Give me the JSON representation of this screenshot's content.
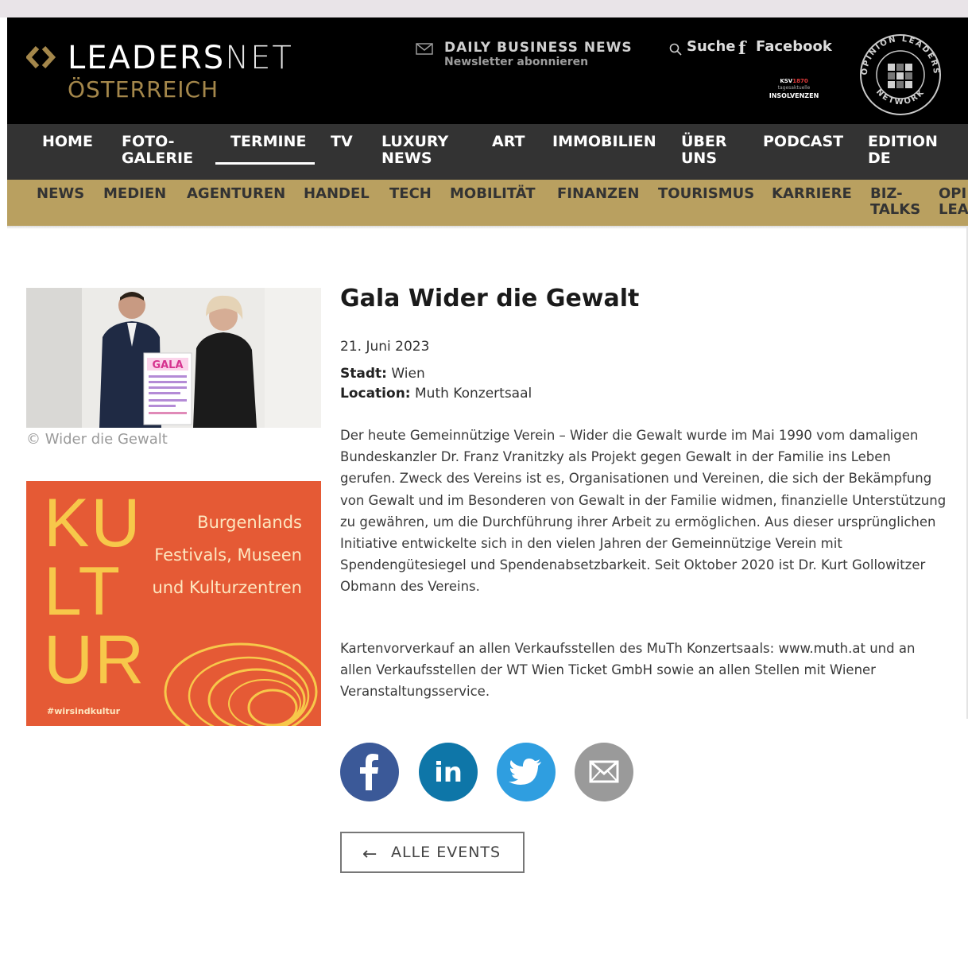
{
  "header": {
    "logo_main_strong": "LEADERS",
    "logo_main_light": "NET",
    "logo_sub": "ÖSTERREICH",
    "newsletter_title": "DAILY BUSINESS NEWS",
    "newsletter_sub": "Newsletter abonnieren",
    "search_label": "Suche",
    "facebook_icon": "f",
    "facebook_label": "Facebook",
    "ksv_brand": "KSV",
    "ksv_brand_accent": "1870",
    "ksv_line": "tagesaktuelle",
    "ksv_title": "INSOLVENZEN",
    "badge_text_top": "OPINION LEADERS",
    "badge_text_bottom": "NETWORK"
  },
  "main_nav": {
    "home": "HOME",
    "foto_1": "FOTO-",
    "foto_2": "GALERIE",
    "termine": "TERMINE",
    "tv": "TV",
    "luxury_1": "LUXURY",
    "luxury_2": "NEWS",
    "art": "ART",
    "immobilien": "IMMOBILIEN",
    "ueber_1": "ÜBER",
    "ueber_2": "UNS",
    "podcast": "PODCAST",
    "edition_1": "EDITION",
    "edition_2": "DE"
  },
  "sub_nav": {
    "news": "NEWS",
    "medien": "MEDIEN",
    "agenturen": "AGENTUREN",
    "handel": "HANDEL",
    "tech": "TECH",
    "mobilitaet": "MOBILITÄT",
    "finanzen": "FINANZEN",
    "tourismus": "TOURISMUS",
    "karriere": "KARRIERE",
    "biz_1": "BIZ-",
    "biz_2": "TALKS",
    "opi_1": "OPI",
    "opi_2": "LEA"
  },
  "photo": {
    "poster_text": "GALA",
    "caption": "© Wider die Gewalt"
  },
  "ad": {
    "ku": "KU",
    "lt": "LT",
    "ur": "UR",
    "line1": "Burgenlands",
    "line2": "Festivals, Museen",
    "line3": "und Kulturzentren",
    "tag": "#wirsindkultur"
  },
  "event": {
    "title": "Gala Wider die Gewalt",
    "date": "21. Juni 2023",
    "city_label": "Stadt:",
    "city_value": "Wien",
    "location_label": "Location:",
    "location_value": "Muth Konzertsaal",
    "paragraph1": "Der heute Gemeinnützige Verein – Wider die Gewalt wurde im Mai 1990 vom damaligen Bundeskanzler Dr. Franz Vranitzky als Projekt gegen Gewalt in der Familie ins Leben gerufen. Zweck des Vereins ist es, Organisationen und Vereinen, die sich der Bekämpfung von Gewalt und im Besonderen von Gewalt in der Familie widmen, finanzielle Unterstützung zu gewähren, um die Durchführung ihrer Arbeit zu ermöglichen. Aus dieser ursprünglichen Initiative entwickelte sich in den vielen Jahren der Gemeinnützige Verein mit Spendengütesiegel und Spendenabsetzbarkeit. Seit Oktober 2020 ist Dr. Kurt Gollowitzer Obmann des Vereins.",
    "paragraph2": "Kartenvorverkauf an allen Verkaufsstellen des MuTh Konzertsaals: www.muth.at und an allen Verkaufsstellen der WT Wien Ticket GmbH sowie an allen Stellen mit Wiener Veranstaltungsservice."
  },
  "share": {
    "facebook_icon": "facebook-icon",
    "linkedin_icon": "linkedin-icon",
    "linkedin_text": "in",
    "twitter_icon": "twitter-icon",
    "email_icon": "email-icon"
  },
  "back_button": {
    "arrow": "←",
    "label": "ALLE EVENTS"
  },
  "colors": {
    "header_bg": "#000000",
    "nav_bg": "#333333",
    "subnav_bg": "#b9a060",
    "gold": "#a4874b",
    "facebook": "#3b5998",
    "linkedin": "#0e76a8",
    "twitter": "#2f9ee0",
    "email": "#9a9a9a",
    "ad_bg": "#e55a35",
    "ad_yellow": "#f7c84a"
  }
}
